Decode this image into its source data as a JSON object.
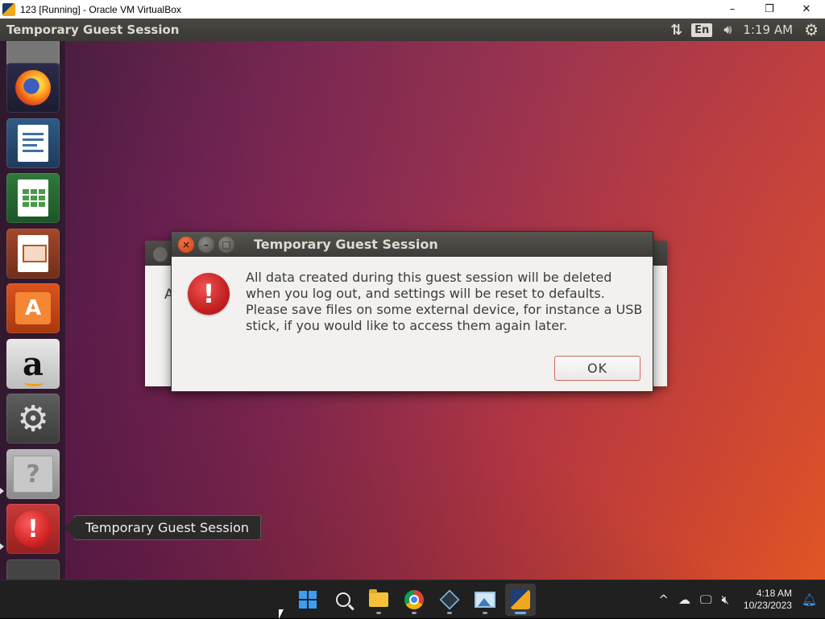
{
  "host_window": {
    "title": "123 [Running] - Oracle VM VirtualBox",
    "controls": {
      "minimize": "–",
      "restore": "❐",
      "close": "✕"
    }
  },
  "top_panel": {
    "title": "Temporary Guest Session",
    "keyboard": "En",
    "clock": "1:19 AM",
    "icons": [
      "network-icon",
      "keyboard-layout-icon",
      "volume-icon",
      "clock",
      "session-gear-icon"
    ]
  },
  "launcher": {
    "items": [
      {
        "name": "firefox",
        "icon": "firefox-icon"
      },
      {
        "name": "libreoffice-writer",
        "icon": "writer-icon"
      },
      {
        "name": "libreoffice-calc",
        "icon": "calc-icon"
      },
      {
        "name": "libreoffice-impress",
        "icon": "impress-icon"
      },
      {
        "name": "ubuntu-software",
        "icon": "software-bag-icon",
        "glyph": "A"
      },
      {
        "name": "amazon",
        "icon": "amazon-icon",
        "glyph": "a"
      },
      {
        "name": "system-settings",
        "icon": "settings-icon"
      },
      {
        "name": "help",
        "icon": "help-icon",
        "glyph": "?"
      },
      {
        "name": "temporary-guest-session",
        "icon": "error-icon",
        "glyph": "!"
      }
    ],
    "tooltip": "Temporary Guest Session"
  },
  "dialog_back": {
    "visible_letter": "A"
  },
  "dialog": {
    "title": "Temporary Guest Session",
    "icon": "error-icon",
    "icon_glyph": "!",
    "message": "All data created during this guest session will be deleted when you log out, and settings will be reset to defaults. Please save files on some external device, for instance a USB stick, if you would like to access them again later.",
    "ok_label": "OK",
    "buttons": {
      "close": "×",
      "minimize": "–",
      "maximize": "□"
    }
  },
  "taskbar": {
    "apps": [
      "start-button",
      "search-button",
      "file-explorer",
      "chrome",
      "virtualbox-3d",
      "photos",
      "virtualbox"
    ],
    "tray": {
      "time": "4:18 AM",
      "date": "10/23/2023",
      "overflow_glyph": "^"
    }
  },
  "colors": {
    "panel": "#3c3b37",
    "error_red": "#c81e1e",
    "ok_border": "#d06a58",
    "taskbar": "#202020",
    "windows_accent": "#3c9df2"
  }
}
